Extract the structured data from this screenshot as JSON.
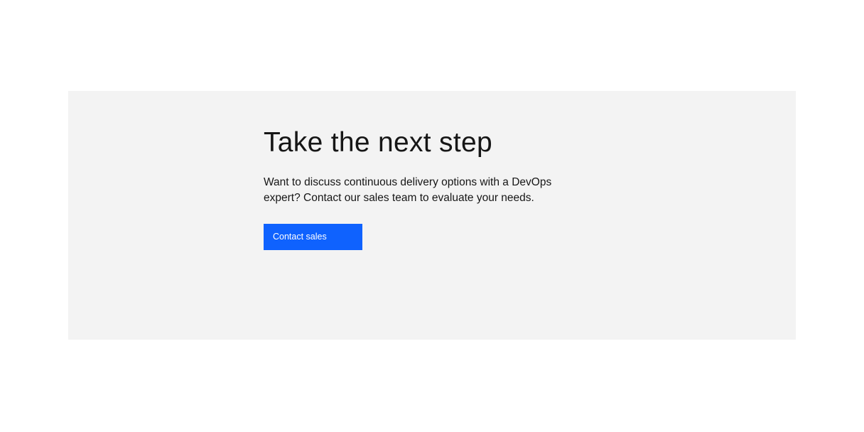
{
  "cta": {
    "heading": "Take the next step",
    "body": "Want to discuss continuous delivery options with a DevOps expert? Contact our sales team to evaluate your needs.",
    "button_label": "Contact sales"
  },
  "colors": {
    "panel_background": "#f3f3f3",
    "button_background": "#0f62fe",
    "text": "#161616"
  }
}
